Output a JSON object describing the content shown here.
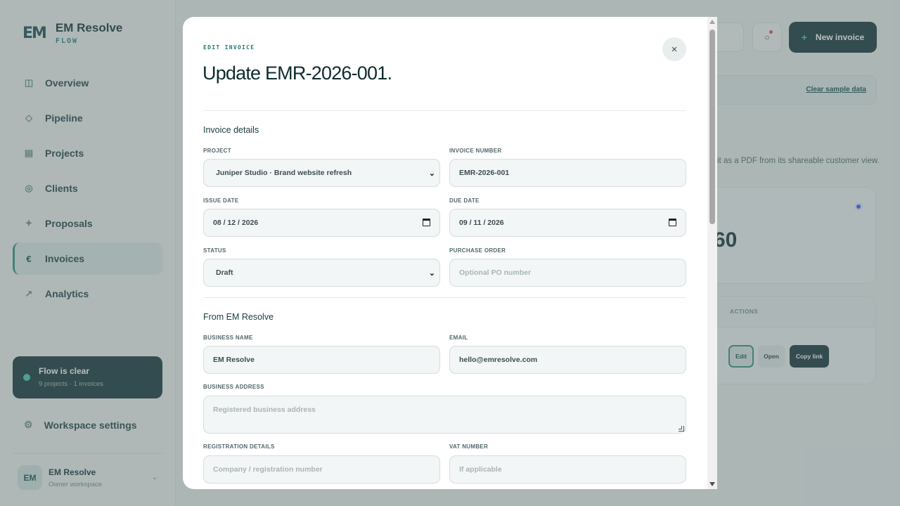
{
  "sidebar": {
    "logo": "EM",
    "brand_name": "EM Resolve",
    "brand_sub": "FLOW",
    "nav": [
      {
        "label": "Overview",
        "icon": "columns-icon",
        "glyph": "◫"
      },
      {
        "label": "Pipeline",
        "icon": "diamond-icon",
        "glyph": "◇"
      },
      {
        "label": "Projects",
        "icon": "list-icon",
        "glyph": "▤"
      },
      {
        "label": "Clients",
        "icon": "target-icon",
        "glyph": "◎"
      },
      {
        "label": "Proposals",
        "icon": "sparkle-icon",
        "glyph": "✦"
      },
      {
        "label": "Invoices",
        "icon": "euro-icon",
        "glyph": "€",
        "active": true
      },
      {
        "label": "Analytics",
        "icon": "trend-arrow-icon",
        "glyph": "↗"
      }
    ],
    "flow_card": {
      "title": "Flow is clear",
      "subtitle": "9 projects · 1 invoices"
    },
    "settings_label": "Workspace settings",
    "settings_glyph": "⚙",
    "user": {
      "initials": "EM",
      "name": "EM Resolve",
      "role": "Owner workspace",
      "chevron": "⌄"
    }
  },
  "header": {
    "notify_glyph": "○",
    "new_invoice_plus": "+",
    "new_invoice_label": "New invoice",
    "clear_sample_label": "Clear sample data"
  },
  "page": {
    "subtitle_fragment": "it as a PDF from its shareable customer view.",
    "stat_value_fragment": "60",
    "table_actions_header": "ACTIONS",
    "row_actions": {
      "edit": "Edit",
      "open": "Open",
      "copy": "Copy link"
    }
  },
  "modal": {
    "eyebrow": "EDIT INVOICE",
    "title": "Update EMR-2026-001.",
    "close_glyph": "×",
    "invoice_details": {
      "heading": "Invoice details",
      "project_label": "PROJECT",
      "project_value": "Juniper Studio · Brand website refresh",
      "invoice_number_label": "INVOICE NUMBER",
      "invoice_number_value": "EMR-2026-001",
      "issue_date_label": "ISSUE DATE",
      "issue_date_value": "08 / 12 / 2026",
      "due_date_label": "DUE DATE",
      "due_date_value": "09 / 11 / 2026",
      "status_label": "STATUS",
      "status_value": "Draft",
      "po_label": "PURCHASE ORDER",
      "po_placeholder": "Optional PO number"
    },
    "from": {
      "heading": "From EM Resolve",
      "business_name_label": "BUSINESS NAME",
      "business_name_value": "EM Resolve",
      "email_label": "EMAIL",
      "email_value": "hello@emresolve.com",
      "address_label": "BUSINESS ADDRESS",
      "address_placeholder": "Registered business address",
      "registration_label": "REGISTRATION DETAILS",
      "registration_placeholder": "Company / registration number",
      "vat_label": "VAT NUMBER",
      "vat_placeholder": "If applicable"
    },
    "chevron_glyph": "⌄"
  },
  "colors": {
    "brand_dark": "#0d2f33",
    "brand_accent": "#1f7a74",
    "success_dot": "#3cc9a2",
    "overlay": "rgba(98,112,113,0.45)"
  }
}
